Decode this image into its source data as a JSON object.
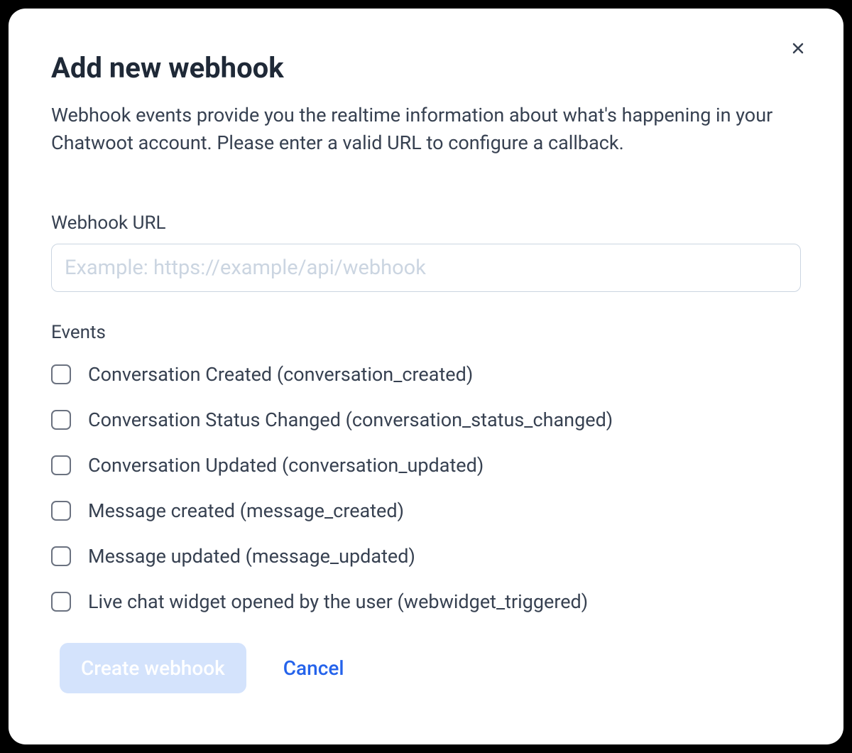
{
  "modal": {
    "title": "Add new webhook",
    "description": "Webhook events provide you the realtime information about what's happening in your Chatwoot account. Please enter a valid URL to configure a callback."
  },
  "url_field": {
    "label": "Webhook URL",
    "placeholder": "Example: https://example/api/webhook",
    "value": ""
  },
  "events": {
    "label": "Events",
    "items": [
      {
        "label": "Conversation Created (conversation_created)",
        "checked": false
      },
      {
        "label": "Conversation Status Changed (conversation_status_changed)",
        "checked": false
      },
      {
        "label": "Conversation Updated (conversation_updated)",
        "checked": false
      },
      {
        "label": "Message created (message_created)",
        "checked": false
      },
      {
        "label": "Message updated (message_updated)",
        "checked": false
      },
      {
        "label": "Live chat widget opened by the user (webwidget_triggered)",
        "checked": false
      }
    ]
  },
  "buttons": {
    "create": "Create webhook",
    "cancel": "Cancel"
  }
}
